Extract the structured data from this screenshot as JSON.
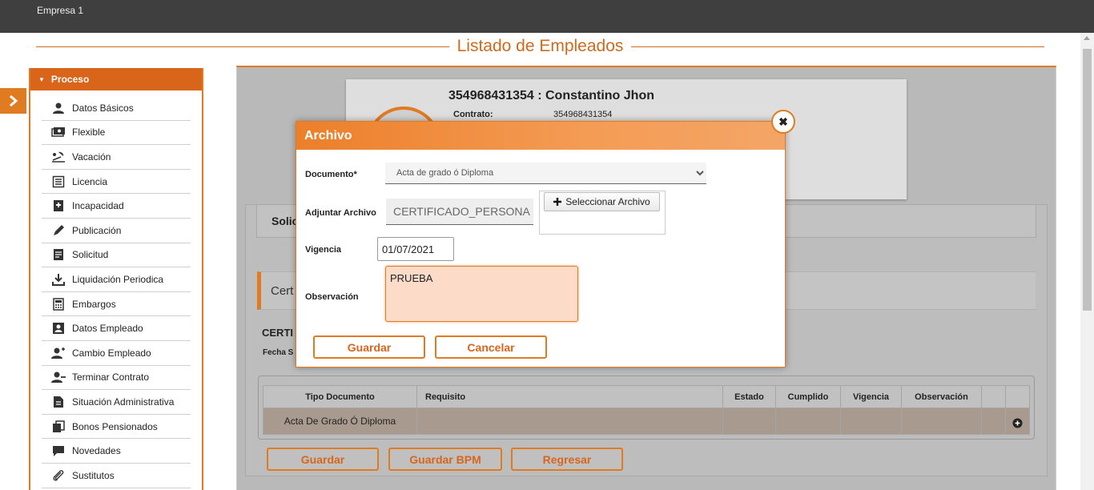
{
  "header": {
    "company": "Empresa 1"
  },
  "page": {
    "title": "Listado de Empleados"
  },
  "sidebar": {
    "section": "Proceso",
    "items": [
      {
        "label": "Datos Básicos",
        "icon": "user-icon"
      },
      {
        "label": "Flexible",
        "icon": "money-icon"
      },
      {
        "label": "Vacación",
        "icon": "beach-icon"
      },
      {
        "label": "Licencia",
        "icon": "list-icon"
      },
      {
        "label": "Incapacidad",
        "icon": "medical-icon"
      },
      {
        "label": "Publicación",
        "icon": "pen-icon"
      },
      {
        "label": "Solicitud",
        "icon": "document-icon"
      },
      {
        "label": "Liquidación Periodica",
        "icon": "download-icon"
      },
      {
        "label": "Embargos",
        "icon": "calculator-icon"
      },
      {
        "label": "Datos Empleado",
        "icon": "id-card-icon"
      },
      {
        "label": "Cambio Empleado",
        "icon": "user-edit-icon"
      },
      {
        "label": "Terminar Contrato",
        "icon": "user-remove-icon"
      },
      {
        "label": "Situación Administrativa",
        "icon": "file-icon"
      },
      {
        "label": "Bonos Pensionados",
        "icon": "copy-icon"
      },
      {
        "label": "Novedades",
        "icon": "comment-icon"
      },
      {
        "label": "Sustitutos",
        "icon": "paperclip-icon"
      }
    ]
  },
  "employee": {
    "title": "354968431354 : Constantino Jhon",
    "contract_label": "Contrato:",
    "contract_value": "354968431354"
  },
  "solicitud": {
    "title_partial": "Solic"
  },
  "certificate": {
    "bar_partial": "Cert",
    "label_partial": "CERTI",
    "fecha_partial": "Fecha S"
  },
  "table": {
    "headers": [
      "Tipo Documento",
      "Requisito",
      "Estado",
      "Cumplido",
      "Vigencia",
      "Observación",
      "",
      ""
    ],
    "rows": [
      [
        "Acta De Grado Ó Diploma",
        "",
        "",
        "",
        "",
        "",
        "",
        ""
      ]
    ]
  },
  "bottom_buttons": {
    "guardar": "Guardar",
    "guardar_bpm": "Guardar BPM",
    "regresar": "Regresar"
  },
  "modal": {
    "title": "Archivo",
    "documento_label": "Documento*",
    "documento_value": "Acta de grado ó Diploma",
    "adjuntar_label": "Adjuntar Archivo",
    "adjuntar_value": "CERTIFICADO_PERSONA",
    "select_file_label": "Seleccionar Archivo",
    "vigencia_label": "Vigencia",
    "vigencia_value": "01/07/2021",
    "observacion_label": "Observación",
    "observacion_value": "PRUEBA",
    "guardar": "Guardar",
    "cancelar": "Cancelar"
  },
  "colors": {
    "accent": "#e07b22",
    "topbar": "#3f3f3f",
    "row_highlight": "#a99a8f"
  }
}
